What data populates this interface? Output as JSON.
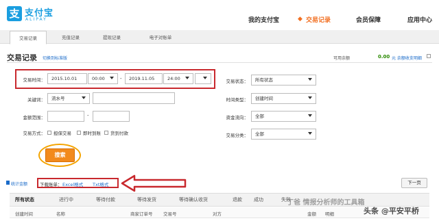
{
  "header": {
    "logo_glyph": "支",
    "logo_cn": "支付宝",
    "logo_en": "ALIPAY",
    "nav": [
      "我的支付宝",
      "交易记录",
      "会员保障",
      "应用中心"
    ]
  },
  "subtabs": [
    "交易记录",
    "充值记录",
    "提现记录",
    "电子对账单"
  ],
  "page": {
    "title": "交易记录",
    "switch_link": "切换到标准版",
    "balance_label": "可用余额",
    "balance_value": "0.00",
    "balance_link": "元 余额收支明细"
  },
  "form": {
    "time_label": "交易时间：",
    "start_date": "2015.10.01",
    "start_time": "00:00",
    "dash": "-",
    "end_date": "2019.11.05",
    "end_time": "24:00",
    "keyword_label": "关键词：",
    "keyword_type": "流水号",
    "keyword_value": "",
    "amount_label": "金额范围：",
    "amount_from": "",
    "amount_dash": "-",
    "amount_to": "",
    "method_label": "交易方式：",
    "methods": [
      "担保交易",
      "即时到账",
      "货到付款"
    ],
    "status_label": "交易状态：",
    "status_value": "所有状态",
    "timetype_label": "时间类型：",
    "timetype_value": "创建时间",
    "flow_label": "资金流向：",
    "flow_value": "全部",
    "category_label": "交易分类：",
    "category_value": "全部",
    "search_button": "搜索"
  },
  "download": {
    "stat_link": "统计金额",
    "label": "下载账单：",
    "excel": "Excel格式",
    "txt": "Txt格式",
    "next_page": "下一页"
  },
  "status_tabs": [
    "所有状态",
    "进行中",
    "等待付款",
    "等待发货",
    "等待确认收货",
    "退款",
    "成功",
    "失败"
  ],
  "columns": [
    "创建时间",
    "名称",
    "商家订单号",
    "交易号",
    "对方",
    "金额",
    "明细"
  ],
  "watermark": {
    "line1": "丁爸 情报分析师的工具箱",
    "line2": "头条 @平安平桥"
  },
  "colors": {
    "brand": "#1a9ee0",
    "accent": "#f26f21",
    "highlight": "#c8282d",
    "search": "#f28a1c"
  }
}
